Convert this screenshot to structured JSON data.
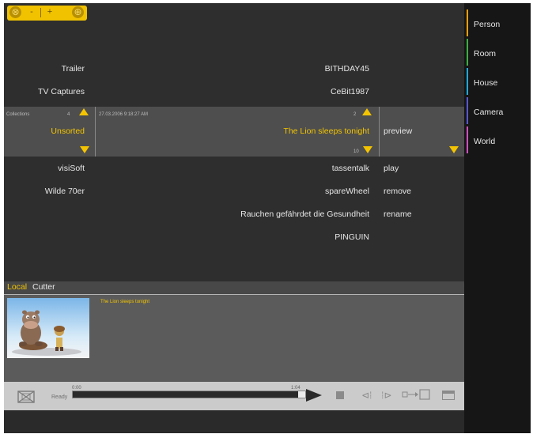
{
  "window": {
    "controls": [
      "⊗",
      "-",
      "+",
      "⊕"
    ]
  },
  "browser": {
    "left_items": [
      "Trailer",
      "TV Captures"
    ],
    "mid_items": [
      "BITHDAY45",
      "CeBit1987"
    ],
    "header": {
      "collections_label": "Collections",
      "collections_count": "4",
      "date": "27.03.2006 9:18:27 AM",
      "mid_count": "2",
      "mid_bottom_count": "10"
    },
    "selected": {
      "collection": "Unsorted",
      "item": "The Lion sleeps tonight",
      "action": "preview"
    },
    "rows": [
      {
        "left": "visiSoft",
        "mid": "tassentalk",
        "action": "play"
      },
      {
        "left": "Wilde 70er",
        "mid": "spareWheel",
        "action": "remove"
      },
      {
        "left": "",
        "mid": "Rauchen gefährdet die Gesundheit",
        "action": "rename"
      },
      {
        "left": "",
        "mid": "PINGUIN",
        "action": ""
      }
    ]
  },
  "cutter": {
    "tab_local": "Local",
    "tab_cutter": "Cutter",
    "clip_title": "The Lion sleeps tonight"
  },
  "player": {
    "status": "Ready",
    "time_start": "0:00",
    "time_end": "1:04",
    "progress": 0.97
  },
  "sidebar": {
    "items": [
      {
        "label": "Person",
        "color": "#f2a000"
      },
      {
        "label": "Room",
        "color": "#3cb040"
      },
      {
        "label": "House",
        "color": "#22a8d8"
      },
      {
        "label": "Camera",
        "color": "#5858d0"
      },
      {
        "label": "World",
        "color": "#d050c0"
      }
    ]
  }
}
